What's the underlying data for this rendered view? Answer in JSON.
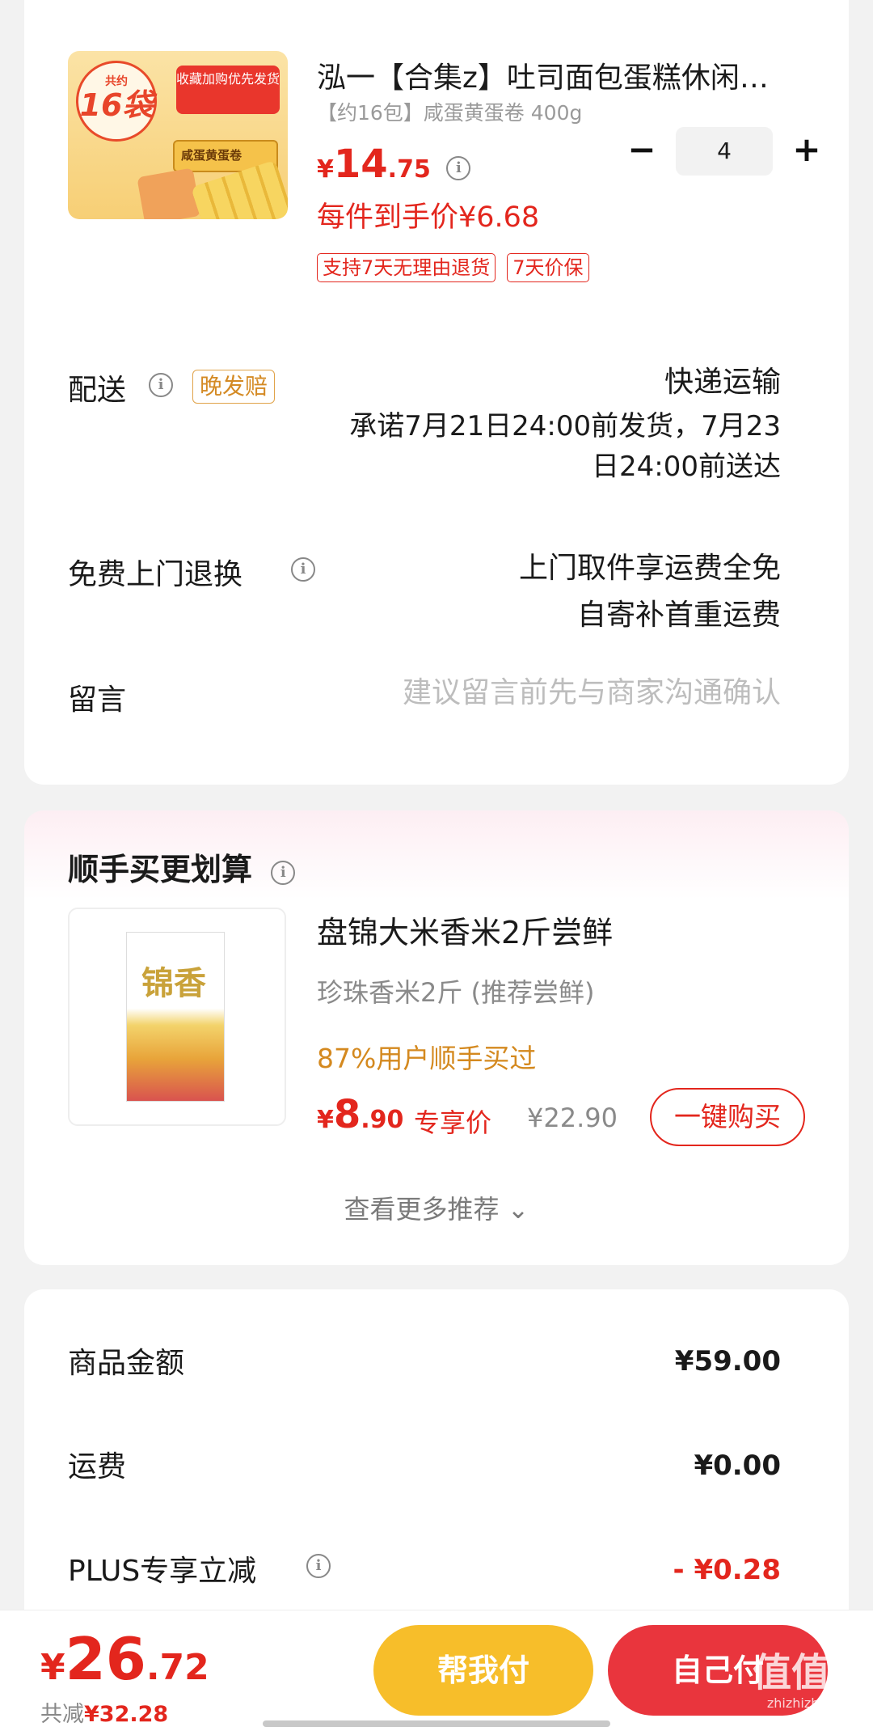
{
  "product": {
    "image": {
      "badge_top": "共约",
      "badge_count": "16袋",
      "promo": "收藏加购优先发货",
      "package_label": "咸蛋黄蛋卷"
    },
    "title": "泓一【合集z】吐司面包蛋糕休闲…",
    "spec": "【约16包】咸蛋黄蛋卷 400g",
    "price": {
      "currency": "¥",
      "integer": "14",
      "decimal": ".75"
    },
    "quantity": "4",
    "unit_price": "每件到手价¥6.68",
    "tags": [
      "支持7天无理由退货",
      "7天价保"
    ]
  },
  "delivery": {
    "label": "配送",
    "badge": "晚发赔",
    "method": "快递运输",
    "promise_line1": "承诺7月21日24:00前发货，7月23",
    "promise_line2": "日24:00前送达"
  },
  "return_service": {
    "label": "免费上门退换",
    "line1": "上门取件享运费全免",
    "line2": "自寄补首重运费"
  },
  "message": {
    "label": "留言",
    "placeholder": "建议留言前先与商家沟通确认"
  },
  "upsell": {
    "title": "顺手买更划算",
    "item": {
      "image_text": "锦香",
      "name": "盘锦大米香米2斤尝鲜",
      "sub": "珍珠香米2斤 (推荐尝鲜)",
      "stat": "87%用户顺手买过",
      "price": {
        "currency": "¥",
        "integer": "8",
        "decimal": ".90"
      },
      "exclusive": "专享价",
      "original": "¥22.90",
      "buy_label": "一键购买"
    },
    "more": "查看更多推荐 ⌄"
  },
  "summary": {
    "goods_label": "商品金额",
    "goods_value": "¥59.00",
    "freight_label": "运费",
    "freight_value": "¥0.00",
    "plus_label": "PLUS专享立减",
    "plus_value": "- ¥0.28"
  },
  "bottom": {
    "total": {
      "currency": "¥",
      "integer": "26",
      "decimal": ".72"
    },
    "saved_prefix": "共减",
    "saved_value": "¥32.28",
    "pay_help": "帮我付",
    "pay_self": "自己付"
  },
  "watermark": {
    "line1": "值值值",
    "line2": "zhizhizhi.com"
  },
  "colors": {
    "accent": "#e3261d",
    "yellow_button": "#f7be2a",
    "red_button": "#e9353d",
    "orange_text": "#d4891f"
  }
}
